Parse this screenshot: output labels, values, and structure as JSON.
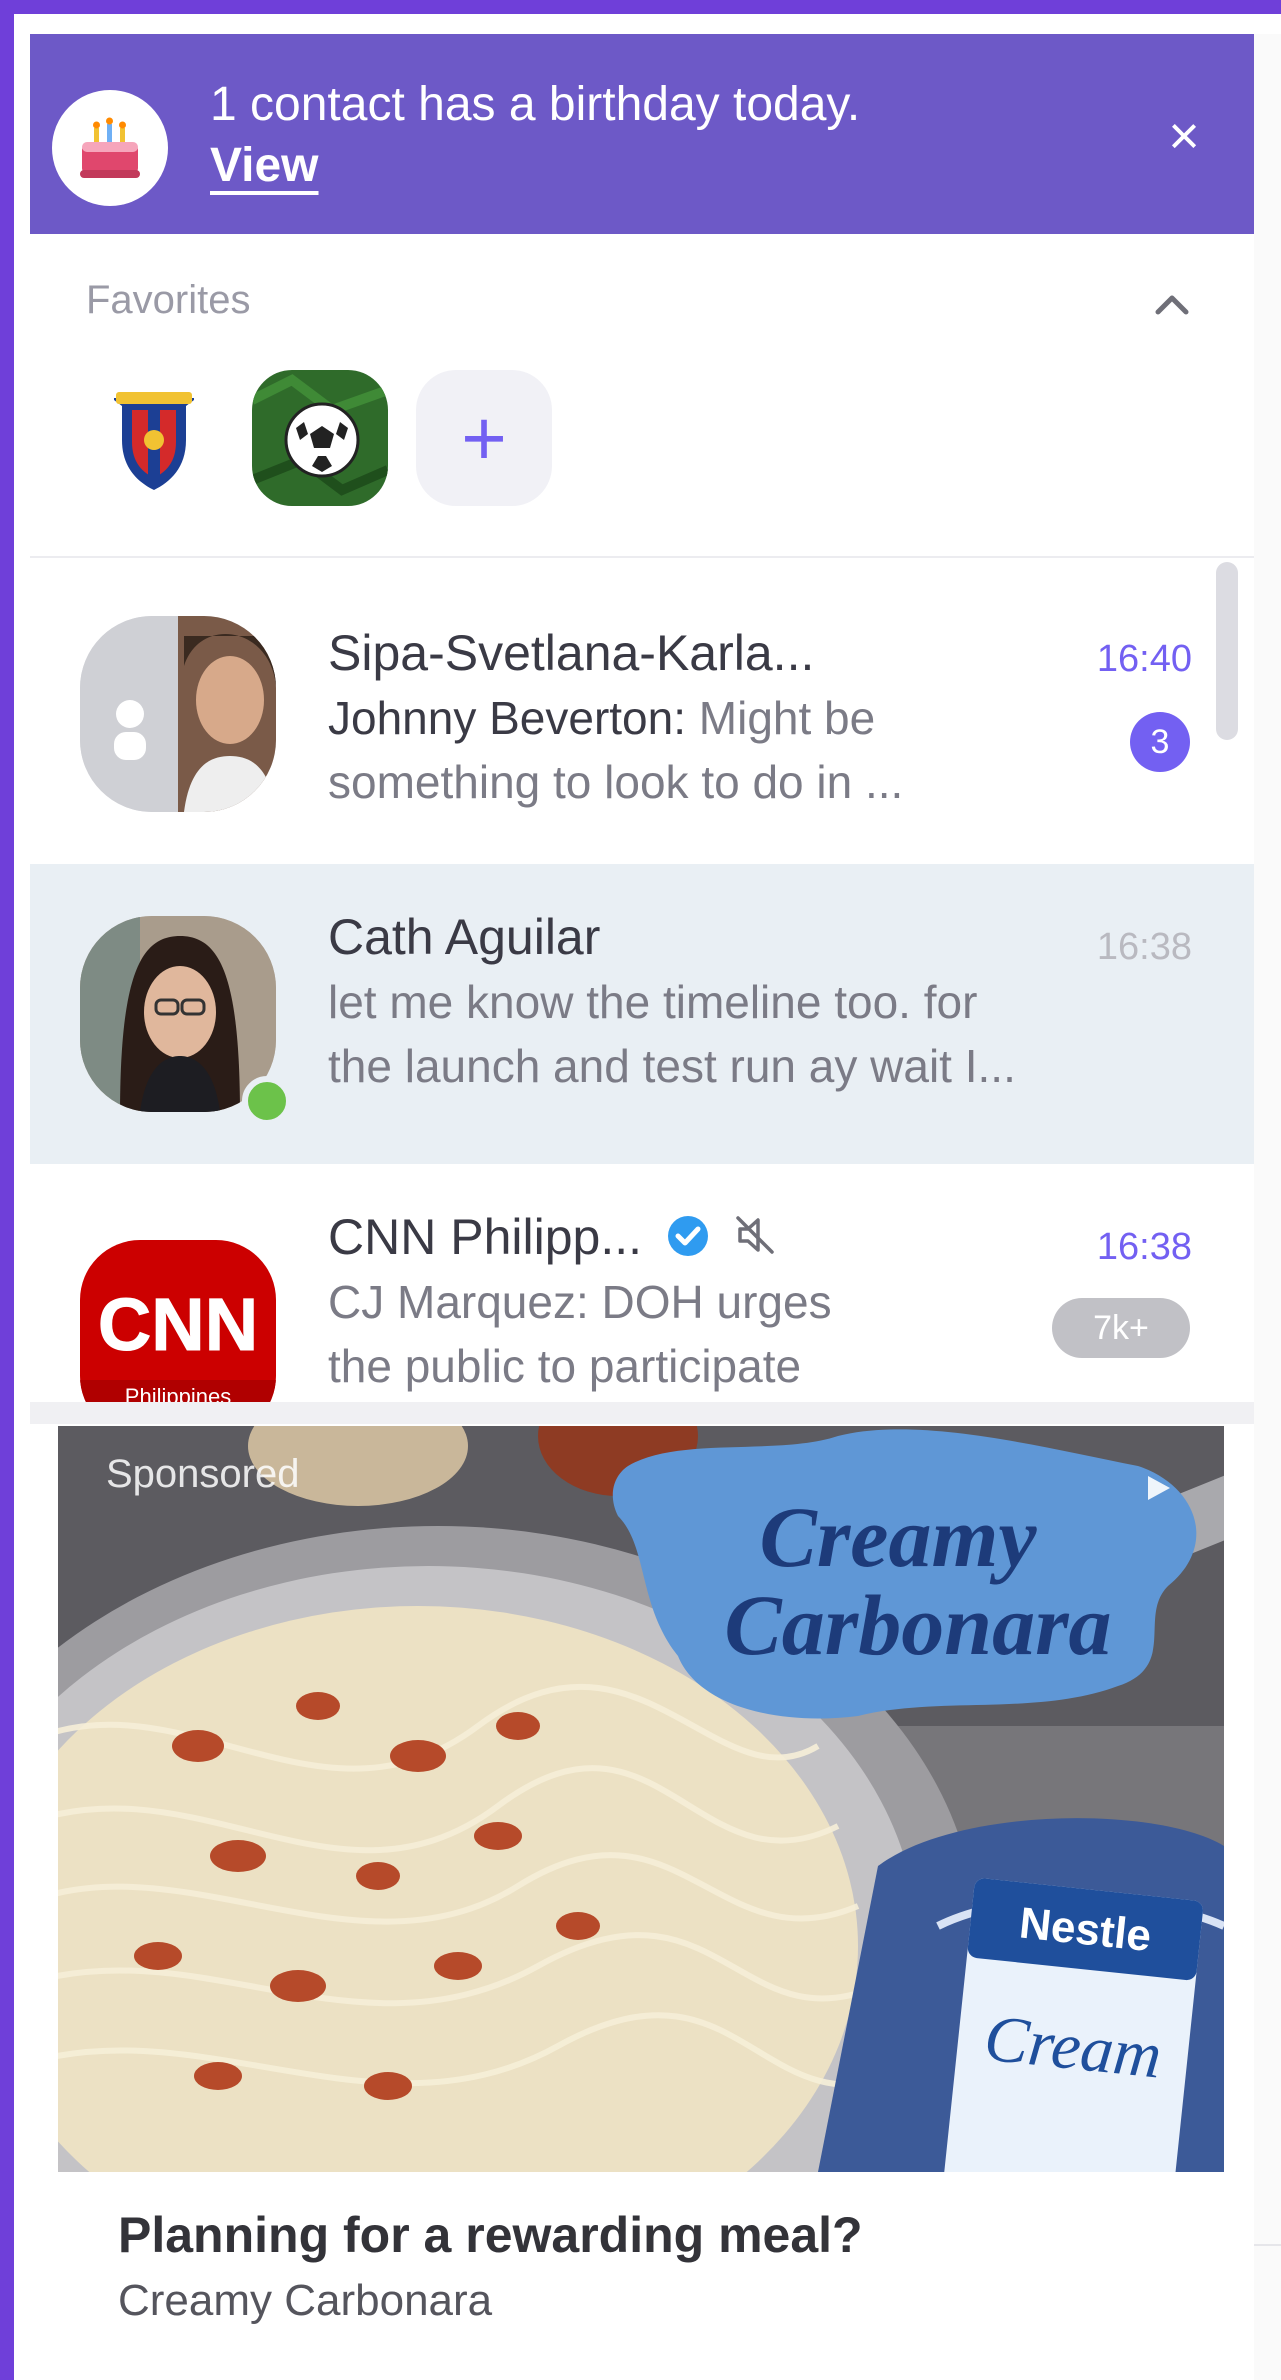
{
  "birthday_banner": {
    "message": "1 contact has a birthday today.",
    "link": "View",
    "close": "×"
  },
  "favorites": {
    "title": "Favorites",
    "add": "+"
  },
  "chats": [
    {
      "name": "Sipa-Svetlana-Karla...",
      "sender": "Johnny Beverton:",
      "message_line1": " Might be",
      "message_line2": "something to look to do in ...",
      "time": "16:40",
      "badge": "3"
    },
    {
      "name": "Cath Aguilar",
      "message_line1": "let me know the timeline too. for",
      "message_line2": "the launch and test run ay wait I...",
      "time": "16:38"
    },
    {
      "name": "CNN Philipp...",
      "message_line1": "CJ Marquez: DOH urges",
      "message_line2": "the public to participate",
      "time": "16:38",
      "badge": "7k+",
      "logo_text": "CNN",
      "logo_sub": "Philippines"
    }
  ],
  "ad": {
    "label": "Sponsored",
    "image_title_line1": "Creamy",
    "image_title_line2": "Carbonara",
    "product_brand": "Nestle",
    "product_name": "Cream",
    "headline": "Planning for a rewarding meal?",
    "subline": "Creamy Carbonara"
  },
  "colors": {
    "accent": "#7360f2",
    "banner": "#6d59c7",
    "window_border": "#6f3fd9",
    "selected_row": "#e9eff4",
    "online": "#6cc24a",
    "verified": "#2f9bf0"
  }
}
